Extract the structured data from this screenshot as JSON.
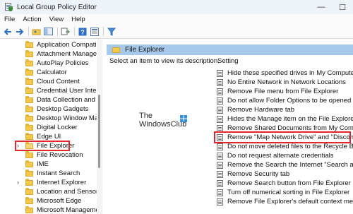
{
  "window": {
    "title": "Local Group Policy Editor",
    "controls": [
      "—",
      "☐"
    ]
  },
  "menu": [
    "File",
    "Action",
    "View",
    "Help"
  ],
  "toolbar": {
    "buttons": [
      "back-arrow-icon",
      "forward-arrow-icon",
      "up-folder-icon",
      "show-hide-tree-icon",
      "export-list-icon",
      "help-icon",
      "properties-icon",
      "filter-icon"
    ]
  },
  "tree": {
    "items": [
      {
        "label": "Application Compatibi"
      },
      {
        "label": "Attachment Manager"
      },
      {
        "label": "AutoPlay Policies"
      },
      {
        "label": "Calculator"
      },
      {
        "label": "Cloud Content"
      },
      {
        "label": "Credential User Interfa"
      },
      {
        "label": "Data Collection and Pr"
      },
      {
        "label": "Desktop Gadgets"
      },
      {
        "label": "Desktop Window Mana"
      },
      {
        "label": "Digital Locker"
      },
      {
        "label": "Edge UI"
      },
      {
        "label": "File Explorer",
        "selected": true,
        "expander": "›"
      },
      {
        "label": "File Revocation"
      },
      {
        "label": "IME"
      },
      {
        "label": "Instant Search"
      },
      {
        "label": "Internet Explorer",
        "expander": "›"
      },
      {
        "label": "Location and Sensors"
      },
      {
        "label": "Microsoft Edge"
      },
      {
        "label": "Microsoft Managemen"
      }
    ]
  },
  "details": {
    "header": "File Explorer",
    "description": "Select an item to view its description.",
    "watermark": {
      "line1": "The",
      "line2": "WindowsClub"
    },
    "settings_header": "Setting",
    "settings": [
      "Hide these specified drives in My Computer",
      "No Entire Network in Network Locations",
      "Remove File menu from File Explorer",
      "Do not allow Folder Options to be opened fro",
      "Remove Hardware tab",
      "Hides the Manage item on the File Explorer co",
      "Remove Shared Documents from My Compu",
      "Remove \"Map Network Drive\" and \"Disconne",
      "Do not move deleted files to the Recycle Bin",
      "Do not request alternate credentials",
      "Remove the Search the Internet \"Search again",
      "Remove Security tab",
      "Remove Search button from File Explorer",
      "Turn off numerical sorting in File Explorer",
      "Remove File Explorer's default context menu"
    ]
  },
  "colors": {
    "highlight": "#e3262b",
    "header_bg": "#a6c8ea"
  }
}
